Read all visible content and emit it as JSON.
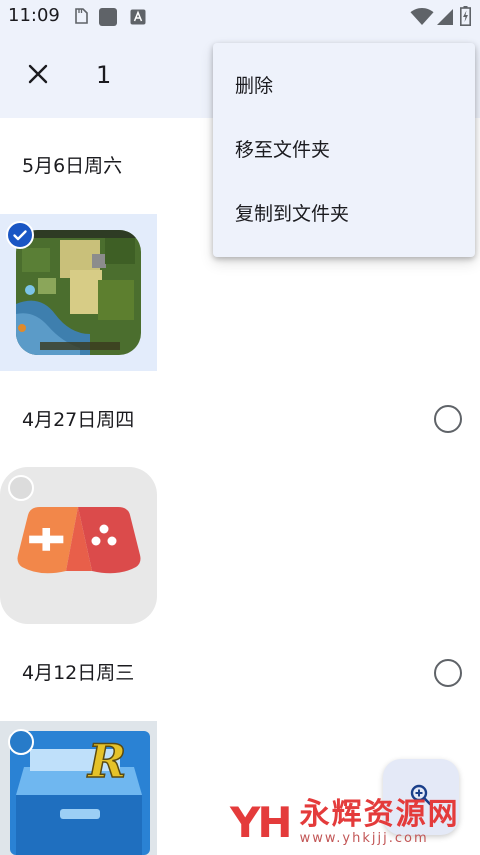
{
  "status_bar": {
    "time": "11:09",
    "left_icons": [
      "storage-icon",
      "app-square-icon",
      "text-a-icon"
    ],
    "right_icons": [
      "wifi-icon",
      "cell-signal-icon",
      "battery-charging-icon"
    ]
  },
  "app_bar": {
    "close_icon": "close-icon",
    "selected_count": "1"
  },
  "overflow_menu": {
    "items": [
      {
        "label": "删除"
      },
      {
        "label": "移至文件夹"
      },
      {
        "label": "复制到文件夹"
      }
    ]
  },
  "groups": [
    {
      "date": "5月6日周六",
      "photo": "map-game-thumbnail",
      "photo_selected": true
    },
    {
      "date": "4月27日周四",
      "photo": "game-controller-thumbnail",
      "photo_selected": false,
      "group_selected": false
    },
    {
      "date": "4月12日周三",
      "photo": "file-manager-thumbnail",
      "photo_selected": false,
      "group_selected": false
    }
  ],
  "fab": {
    "icon": "zoom-in-icon"
  },
  "watermark": {
    "logo": "YH",
    "name": "永辉资源网",
    "url": "www.yhkjjj.com"
  },
  "colors": {
    "app_bar_bg": "#eef2fb",
    "accent": "#1a56c4",
    "selected_tile_bg": "#e3ecfb",
    "watermark_red": "#e43b3b"
  }
}
